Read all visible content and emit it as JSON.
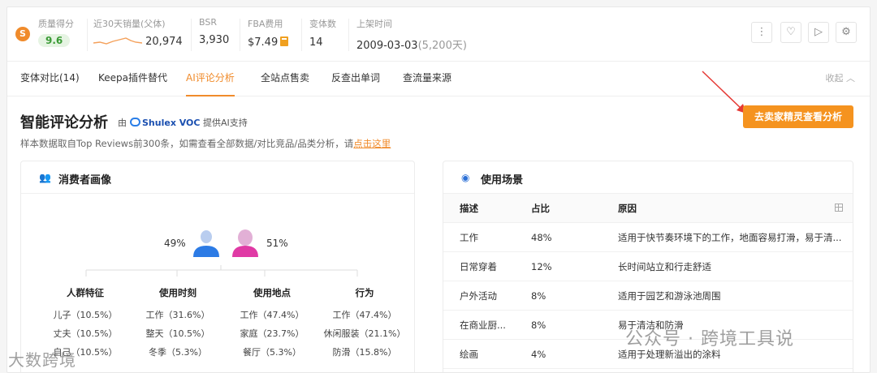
{
  "stats": {
    "quality": {
      "label": "质量得分",
      "value": "9.6"
    },
    "sales30": {
      "label": "近30天销量(父体)",
      "value": "20,974"
    },
    "bsr": {
      "label": "BSR",
      "value": "3,930"
    },
    "fba": {
      "label": "FBA费用",
      "value": "$7.49"
    },
    "variants": {
      "label": "变体数",
      "value": "14"
    },
    "listed": {
      "label": "上架时间",
      "date": "2009-03-03",
      "days": "(5,200天)"
    }
  },
  "tabs": [
    "变体对比(14)",
    "Keepa插件替代",
    "AI评论分析",
    "全站点售卖",
    "反查出单词",
    "查流量来源"
  ],
  "collapse_label": "收起",
  "section": {
    "title": "智能评论分析",
    "by_prefix": "由",
    "brand": "Shulex VOC",
    "by_suffix": "提供AI支持",
    "desc": "样本数据取自Top Reviews前300条，如需查看全部数据/对比竞品/品类分析，请",
    "desc_link": "点击这里",
    "cta": "去卖家精灵查看分析"
  },
  "persona": {
    "title": "消费者画像",
    "male_pct": "49%",
    "female_pct": "51%",
    "groups": [
      {
        "header": "人群特征",
        "items": [
          "儿子（10.5%）",
          "丈夫（10.5%）",
          "自己（10.5%）"
        ]
      },
      {
        "header": "使用时刻",
        "items": [
          "工作（31.6%）",
          "整天（10.5%）",
          "冬季（5.3%）"
        ]
      },
      {
        "header": "使用地点",
        "items": [
          "工作（47.4%）",
          "家庭（23.7%）",
          "餐厅（5.3%）"
        ]
      },
      {
        "header": "行为",
        "items": [
          "工作（47.4%）",
          "休闲服装（21.1%）",
          "防滑（15.8%）"
        ]
      }
    ]
  },
  "scenarios": {
    "title": "使用场景",
    "columns": [
      "描述",
      "占比",
      "原因"
    ],
    "rows": [
      {
        "desc": "工作",
        "pct": "48%",
        "reason": "适用于快节奏环境下的工作，地面容易打滑，易于清..."
      },
      {
        "desc": "日常穿着",
        "pct": "12%",
        "reason": "长时间站立和行走舒适"
      },
      {
        "desc": "户外活动",
        "pct": "8%",
        "reason": "适用于园艺和游泳池周围"
      },
      {
        "desc": "在商业厨...",
        "pct": "8%",
        "reason": "易于清洁和防滑"
      },
      {
        "desc": "绘画",
        "pct": "4%",
        "reason": "适用于处理新溢出的涂料"
      }
    ]
  },
  "watermarks": {
    "left": "大数跨境",
    "right": "公众号 · 跨境工具说"
  }
}
